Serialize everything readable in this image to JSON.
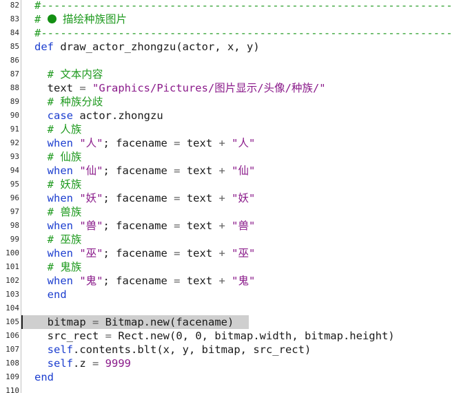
{
  "lines": [
    {
      "no": "82",
      "segs": [
        {
          "t": "#----------------------------------------------------------------",
          "c": "comment"
        }
      ]
    },
    {
      "no": "83",
      "segs": [
        {
          "t": "# ",
          "c": "comment"
        },
        {
          "icon": "bullet-icon"
        },
        {
          "t": " 描绘种族图片",
          "c": "comment"
        }
      ]
    },
    {
      "no": "84",
      "segs": [
        {
          "t": "#----------------------------------------------------------------",
          "c": "comment"
        }
      ]
    },
    {
      "no": "85",
      "segs": [
        {
          "t": "def",
          "c": "kw"
        },
        {
          "t": " draw_actor_zhongzu",
          "c": "plain"
        },
        {
          "t": "(",
          "c": "paren"
        },
        {
          "t": "actor, x, y",
          "c": "plain"
        },
        {
          "t": ")",
          "c": "paren"
        }
      ]
    },
    {
      "no": "86",
      "segs": []
    },
    {
      "no": "87",
      "segs": [
        {
          "t": "  # 文本内容",
          "c": "comment"
        }
      ]
    },
    {
      "no": "88",
      "segs": [
        {
          "t": "  text ",
          "c": "plain"
        },
        {
          "t": "=",
          "c": "op"
        },
        {
          "t": " \"Graphics/Pictures/图片显示/头像/种族/\"",
          "c": "str"
        }
      ]
    },
    {
      "no": "89",
      "segs": [
        {
          "t": "  # 种族分歧",
          "c": "comment"
        }
      ]
    },
    {
      "no": "90",
      "segs": [
        {
          "t": "  case",
          "c": "kw"
        },
        {
          "t": " actor.zhongzu",
          "c": "plain"
        }
      ]
    },
    {
      "no": "91",
      "segs": [
        {
          "t": "  # 人族",
          "c": "comment"
        }
      ]
    },
    {
      "no": "92",
      "segs": [
        {
          "t": "  when",
          "c": "kw"
        },
        {
          "t": " \"人\"",
          "c": "str"
        },
        {
          "t": "; facename ",
          "c": "plain"
        },
        {
          "t": "=",
          "c": "op"
        },
        {
          "t": " text ",
          "c": "plain"
        },
        {
          "t": "+",
          "c": "op"
        },
        {
          "t": " \"人\"",
          "c": "str"
        }
      ]
    },
    {
      "no": "93",
      "segs": [
        {
          "t": "  # 仙族",
          "c": "comment"
        }
      ]
    },
    {
      "no": "94",
      "segs": [
        {
          "t": "  when",
          "c": "kw"
        },
        {
          "t": " \"仙\"",
          "c": "str"
        },
        {
          "t": "; facename ",
          "c": "plain"
        },
        {
          "t": "=",
          "c": "op"
        },
        {
          "t": " text ",
          "c": "plain"
        },
        {
          "t": "+",
          "c": "op"
        },
        {
          "t": " \"仙\"",
          "c": "str"
        }
      ]
    },
    {
      "no": "95",
      "segs": [
        {
          "t": "  # 妖族",
          "c": "comment"
        }
      ]
    },
    {
      "no": "96",
      "segs": [
        {
          "t": "  when",
          "c": "kw"
        },
        {
          "t": " \"妖\"",
          "c": "str"
        },
        {
          "t": "; facename ",
          "c": "plain"
        },
        {
          "t": "=",
          "c": "op"
        },
        {
          "t": " text ",
          "c": "plain"
        },
        {
          "t": "+",
          "c": "op"
        },
        {
          "t": " \"妖\"",
          "c": "str"
        }
      ]
    },
    {
      "no": "97",
      "segs": [
        {
          "t": "  # 兽族",
          "c": "comment"
        }
      ]
    },
    {
      "no": "98",
      "segs": [
        {
          "t": "  when",
          "c": "kw"
        },
        {
          "t": " \"兽\"",
          "c": "str"
        },
        {
          "t": "; facename ",
          "c": "plain"
        },
        {
          "t": "=",
          "c": "op"
        },
        {
          "t": " text ",
          "c": "plain"
        },
        {
          "t": "+",
          "c": "op"
        },
        {
          "t": " \"兽\"",
          "c": "str"
        }
      ]
    },
    {
      "no": "99",
      "segs": [
        {
          "t": "  # 巫族",
          "c": "comment"
        }
      ]
    },
    {
      "no": "100",
      "segs": [
        {
          "t": "  when",
          "c": "kw"
        },
        {
          "t": " \"巫\"",
          "c": "str"
        },
        {
          "t": "; facename ",
          "c": "plain"
        },
        {
          "t": "=",
          "c": "op"
        },
        {
          "t": " text ",
          "c": "plain"
        },
        {
          "t": "+",
          "c": "op"
        },
        {
          "t": " \"巫\"",
          "c": "str"
        }
      ]
    },
    {
      "no": "101",
      "segs": [
        {
          "t": "  # 鬼族",
          "c": "comment"
        }
      ]
    },
    {
      "no": "102",
      "segs": [
        {
          "t": "  when",
          "c": "kw"
        },
        {
          "t": " \"鬼\"",
          "c": "str"
        },
        {
          "t": "; facename ",
          "c": "plain"
        },
        {
          "t": "=",
          "c": "op"
        },
        {
          "t": " text ",
          "c": "plain"
        },
        {
          "t": "+",
          "c": "op"
        },
        {
          "t": " \"鬼\"",
          "c": "str"
        }
      ]
    },
    {
      "no": "103",
      "segs": [
        {
          "t": "  end",
          "c": "kw"
        }
      ]
    },
    {
      "no": "104",
      "segs": []
    },
    {
      "no": "105",
      "current": true,
      "segs": [
        {
          "t": "  bitmap ",
          "c": "plain"
        },
        {
          "t": "=",
          "c": "op"
        },
        {
          "t": " Bitmap.new",
          "c": "plain"
        },
        {
          "t": "(",
          "c": "paren"
        },
        {
          "t": "facename",
          "c": "plain"
        },
        {
          "t": ")",
          "c": "paren"
        }
      ]
    },
    {
      "no": "106",
      "segs": [
        {
          "t": "  src_rect ",
          "c": "plain"
        },
        {
          "t": "=",
          "c": "op"
        },
        {
          "t": " Rect.new",
          "c": "plain"
        },
        {
          "t": "(",
          "c": "paren"
        },
        {
          "t": "0, 0, bitmap.width, bitmap.height",
          "c": "plain"
        },
        {
          "t": ")",
          "c": "paren"
        }
      ]
    },
    {
      "no": "107",
      "segs": [
        {
          "t": "  self",
          "c": "kw"
        },
        {
          "t": ".contents.blt",
          "c": "plain"
        },
        {
          "t": "(",
          "c": "paren"
        },
        {
          "t": "x, y, bitmap, src_rect",
          "c": "plain"
        },
        {
          "t": ")",
          "c": "paren"
        }
      ]
    },
    {
      "no": "108",
      "segs": [
        {
          "t": "  self",
          "c": "kw"
        },
        {
          "t": ".z ",
          "c": "plain"
        },
        {
          "t": "=",
          "c": "op"
        },
        {
          "t": " 9999",
          "c": "str"
        }
      ]
    },
    {
      "no": "109",
      "segs": [
        {
          "t": "end",
          "c": "kw"
        }
      ]
    },
    {
      "no": "110",
      "segs": []
    }
  ],
  "colors": {
    "comment": "#1f9a1f",
    "keyword": "#1c3ecf",
    "string": "#8a1a8a",
    "current_line": "#cfcfcf"
  }
}
